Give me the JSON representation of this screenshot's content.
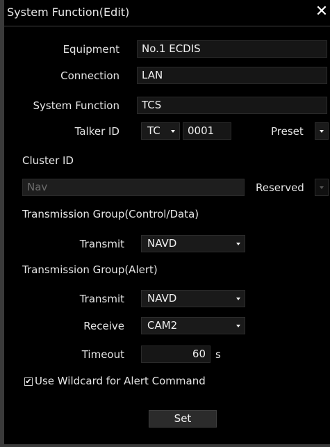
{
  "dialog": {
    "title": "System Function(Edit)",
    "close_icon": "close-icon"
  },
  "equipment": {
    "label": "Equipment",
    "value": "No.1 ECDIS"
  },
  "connection": {
    "label": "Connection",
    "value": "LAN"
  },
  "system_function": {
    "label": "System Function",
    "value": "TCS"
  },
  "talker": {
    "label": "Talker ID",
    "id_value": "TC",
    "number_value": "0001",
    "preset_label": "Preset"
  },
  "cluster": {
    "label": "Cluster ID",
    "value": "Nav",
    "reserved_label": "Reserved"
  },
  "group_control": {
    "heading": "Transmission Group(Control/Data)",
    "transmit_label": "Transmit",
    "transmit_value": "NAVD"
  },
  "group_alert": {
    "heading": "Transmission Group(Alert)",
    "transmit_label": "Transmit",
    "transmit_value": "NAVD",
    "receive_label": "Receive",
    "receive_value": "CAM2",
    "timeout_label": "Timeout",
    "timeout_value": "60",
    "timeout_unit": "s"
  },
  "wildcard": {
    "label": "Use Wildcard for Alert Command",
    "checked": true,
    "check_glyph": "✔"
  },
  "actions": {
    "set_label": "Set"
  },
  "colors": {
    "background": "#000000",
    "field_bg": "#161616",
    "text": "#e6e6e6",
    "dim_text": "#6c6c6c"
  }
}
